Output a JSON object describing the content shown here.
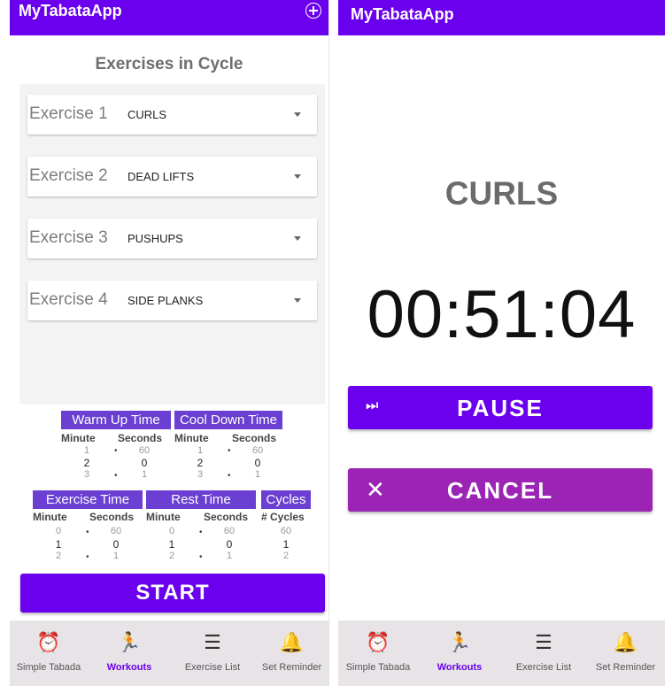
{
  "app": {
    "title": "MyTabataApp"
  },
  "setup": {
    "section_title": "Exercises in Cycle",
    "exercises": [
      {
        "label": "Exercise 1",
        "value": "CURLS"
      },
      {
        "label": "Exercise 2",
        "value": "DEAD LIFTS"
      },
      {
        "label": "Exercise 3",
        "value": "PUSHUPS"
      },
      {
        "label": "Exercise 4",
        "value": "SIDE PLANKS"
      }
    ],
    "warmup": {
      "title": "Warm Up Time",
      "minute_label": "Minute",
      "seconds_label": "Seconds",
      "minute": {
        "prev": "1",
        "sel": "2",
        "next": "3"
      },
      "seconds": {
        "prev": "60",
        "sel": "0",
        "next": "1"
      }
    },
    "cooldown": {
      "title": "Cool Down Time",
      "minute_label": "Minute",
      "seconds_label": "Seconds",
      "minute": {
        "prev": "1",
        "sel": "2",
        "next": "3"
      },
      "seconds": {
        "prev": "60",
        "sel": "0",
        "next": "1"
      }
    },
    "exercise_time": {
      "title": "Exercise Time",
      "minute_label": "Minute",
      "seconds_label": "Seconds",
      "minute": {
        "prev": "0",
        "sel": "1",
        "next": "2"
      },
      "seconds": {
        "prev": "60",
        "sel": "0",
        "next": "1"
      }
    },
    "rest_time": {
      "title": "Rest Time",
      "minute_label": "Minute",
      "seconds_label": "Seconds",
      "minute": {
        "prev": "0",
        "sel": "1",
        "next": "2"
      },
      "seconds": {
        "prev": "60",
        "sel": "0",
        "next": "1"
      }
    },
    "cycles": {
      "title": "Cycles",
      "label": "# Cycles",
      "value": {
        "prev": "60",
        "sel": "1",
        "next": "2"
      }
    },
    "start_label": "START"
  },
  "workout": {
    "current_exercise": "CURLS",
    "countdown": "00:51:04",
    "pause_label": "PAUSE",
    "cancel_label": "CANCEL"
  },
  "nav": {
    "items": [
      {
        "label": "Simple Tabada",
        "icon": "alarm-clock-icon"
      },
      {
        "label": "Workouts",
        "icon": "running-person-icon",
        "active": true
      },
      {
        "label": "Exercise List",
        "icon": "list-icon"
      },
      {
        "label": "Set Reminder",
        "icon": "bell-icon"
      }
    ]
  },
  "colors": {
    "primary": "#6a00ee",
    "timer_header": "#6a3fd1",
    "cancel": "#9b24b5",
    "nav_bg": "#e7e3e7"
  }
}
